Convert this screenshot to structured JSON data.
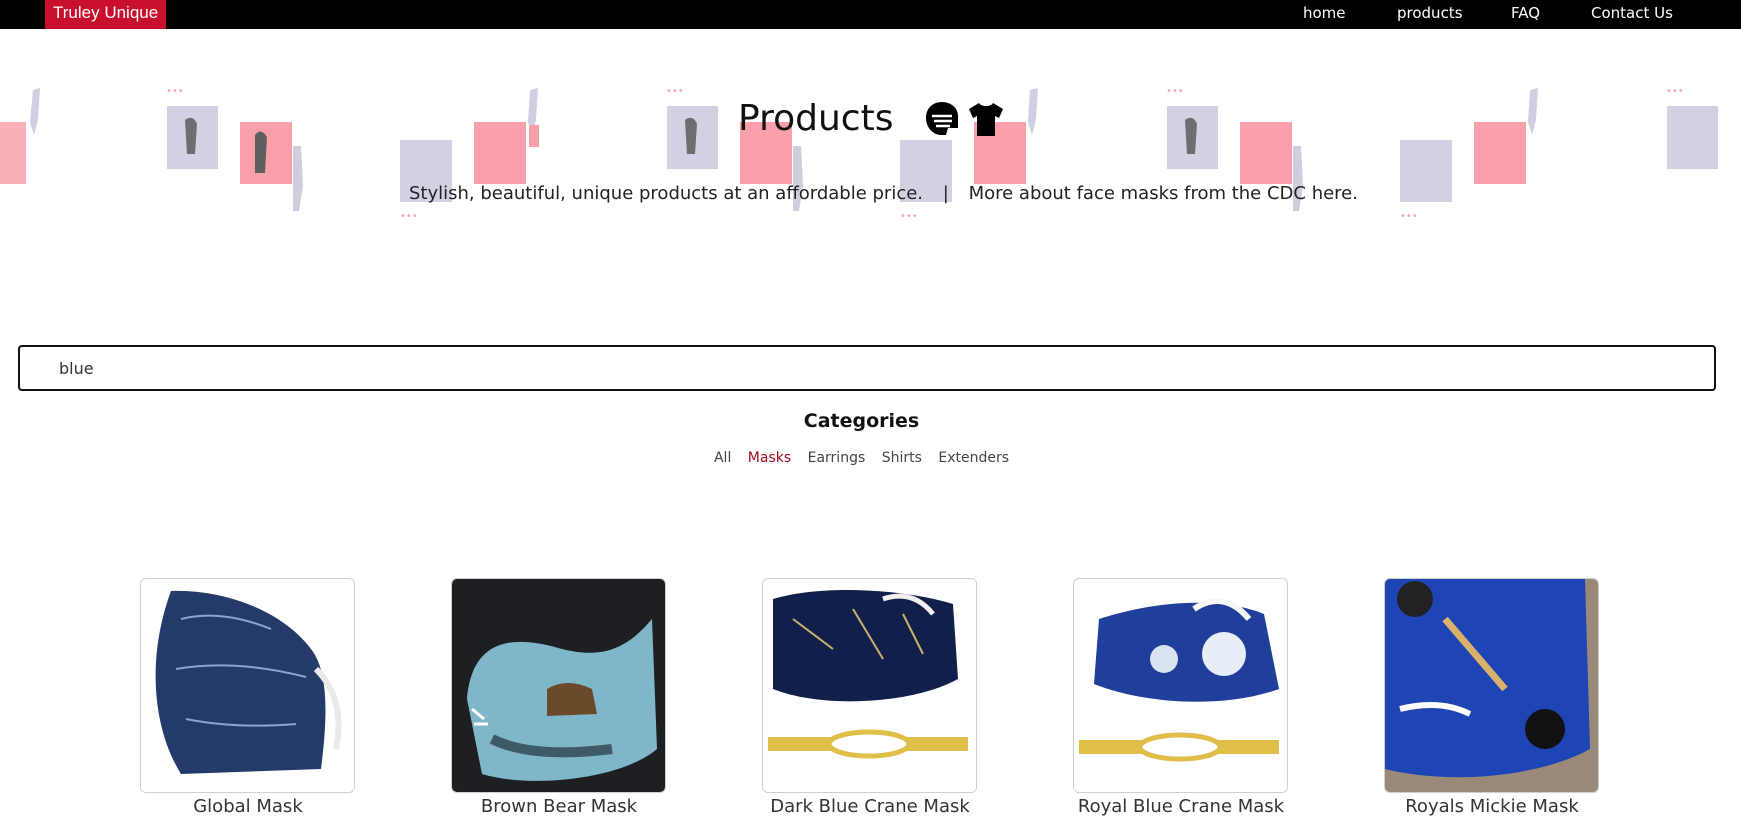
{
  "nav": {
    "brand": "Truley Unique",
    "links": [
      "home",
      "products",
      "FAQ",
      "Contact Us"
    ]
  },
  "hero": {
    "title": "Products",
    "icons": [
      "face-mask-icon",
      "t-shirt-icon"
    ],
    "tagline": "Stylish, beautiful, unique products at an affordable price.",
    "separator": "|",
    "cdc_link": "More about face masks from the CDC here."
  },
  "search": {
    "value": "blue"
  },
  "categories": {
    "title": "Categories",
    "items": [
      "All",
      "Masks",
      "Earrings",
      "Shirts",
      "Extenders"
    ],
    "active": "Masks"
  },
  "products": [
    {
      "name": "Global Mask"
    },
    {
      "name": "Brown Bear Mask"
    },
    {
      "name": "Dark Blue Crane Mask"
    },
    {
      "name": "Royal Blue Crane Mask"
    },
    {
      "name": "Royals Mickie Mask"
    }
  ],
  "colors": {
    "brand": "#c8102e",
    "active_category": "#a00d1e",
    "topbar": "#000000"
  }
}
